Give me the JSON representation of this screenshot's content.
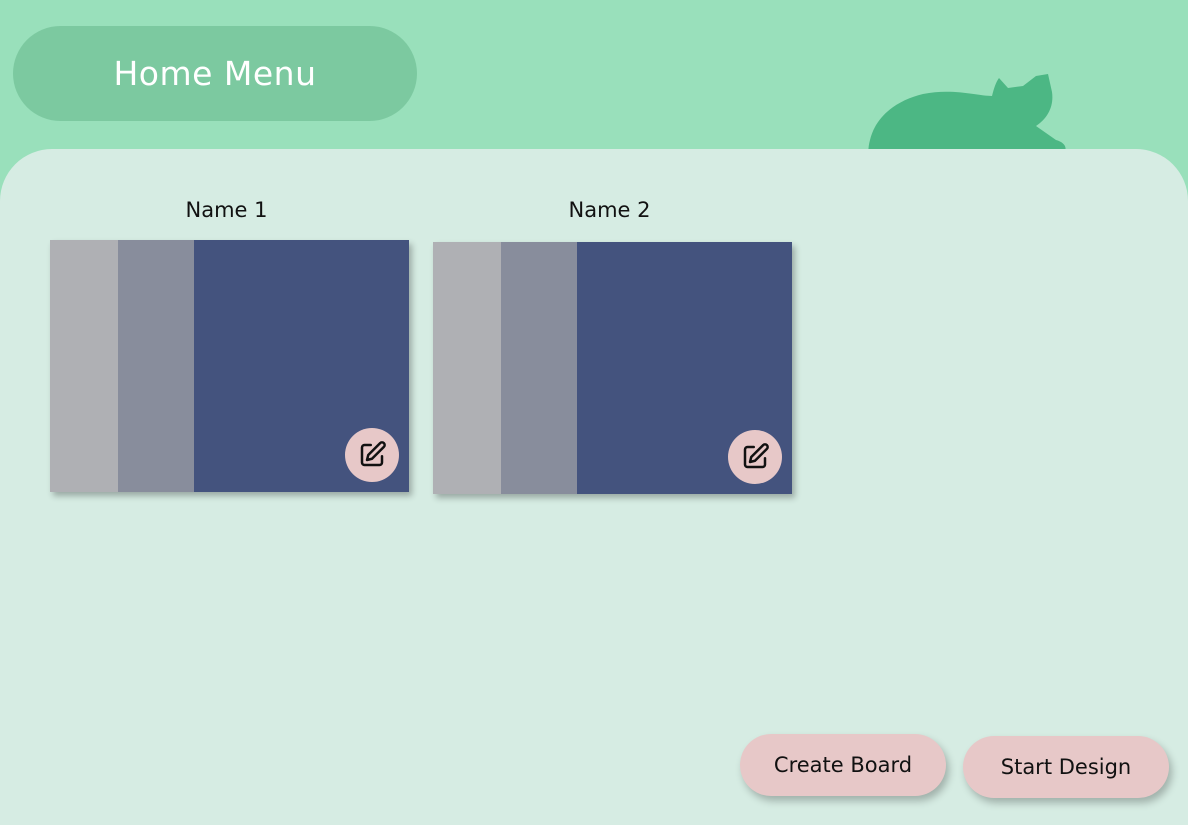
{
  "header": {
    "title": "Home Menu"
  },
  "boards": [
    {
      "name": "Name 1"
    },
    {
      "name": "Name 2"
    }
  ],
  "actions": {
    "create_board_label": "Create Board",
    "start_design_label": "Start Design"
  },
  "colors": {
    "background_top": "#99e0bb",
    "header_pill": "#7cc9a0",
    "panel": "#d6ece3",
    "cat": "#4cb784",
    "strip_light_gray": "#afb0b4",
    "strip_slate": "#888d9c",
    "strip_navy": "#44537e",
    "button_pink": "#e7c8c8"
  },
  "icons": {
    "cat": "cat-silhouette-icon",
    "edit": "edit-square-pencil-icon"
  }
}
